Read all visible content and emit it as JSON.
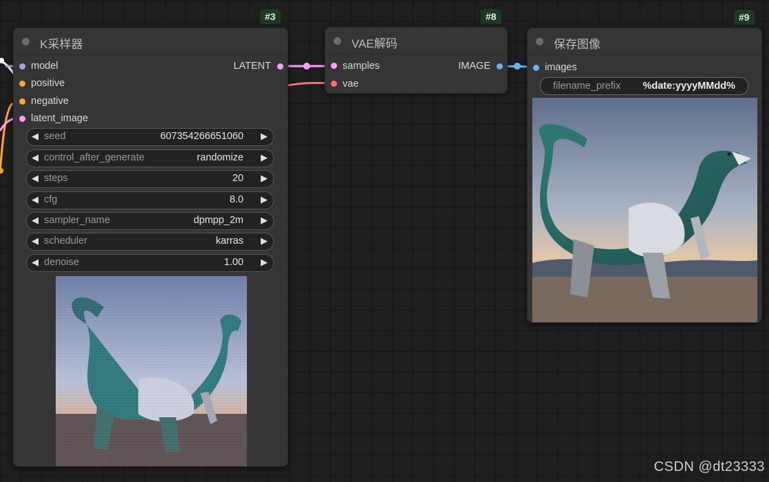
{
  "nodes": {
    "ksampler": {
      "id_badge": "#3",
      "title": "K采样器",
      "inputs": [
        {
          "label": "model",
          "color": "#b39ddb"
        },
        {
          "label": "positive",
          "color": "#ffa726"
        },
        {
          "label": "negative",
          "color": "#ffa726"
        },
        {
          "label": "latent_image",
          "color": "#ff9cf9"
        }
      ],
      "output": {
        "label": "LATENT",
        "color": "#ff9cf9"
      },
      "widgets": [
        {
          "label": "seed",
          "value": "607354266651060"
        },
        {
          "label": "control_after_generate",
          "value": "randomize"
        },
        {
          "label": "steps",
          "value": "20"
        },
        {
          "label": "cfg",
          "value": "8.0"
        },
        {
          "label": "sampler_name",
          "value": "dpmpp_2m"
        },
        {
          "label": "scheduler",
          "value": "karras"
        },
        {
          "label": "denoise",
          "value": "1.00"
        }
      ],
      "arrow_left": "◀",
      "arrow_right": "▶"
    },
    "vae_decode": {
      "id_badge": "#8",
      "title": "VAE解码",
      "inputs": [
        {
          "label": "samples",
          "color": "#ff9cf9"
        },
        {
          "label": "vae",
          "color": "#ff6e6e"
        }
      ],
      "output": {
        "label": "IMAGE",
        "color": "#64b5f6"
      }
    },
    "save_image": {
      "id_badge": "#9",
      "title": "保存图像",
      "inputs": [
        {
          "label": "images",
          "color": "#64b5f6"
        }
      ],
      "filename_prefix": {
        "label": "filename_prefix",
        "value": "%date:yyyyMMdd%"
      }
    }
  },
  "colors": {
    "latent_link": "#ff9cf9",
    "vae_link": "#ff6e6e",
    "image_link": "#64b5f6",
    "conditioning_link": "#ffa726",
    "model_link": "#ffffff"
  },
  "watermark": "CSDN @dt23333"
}
